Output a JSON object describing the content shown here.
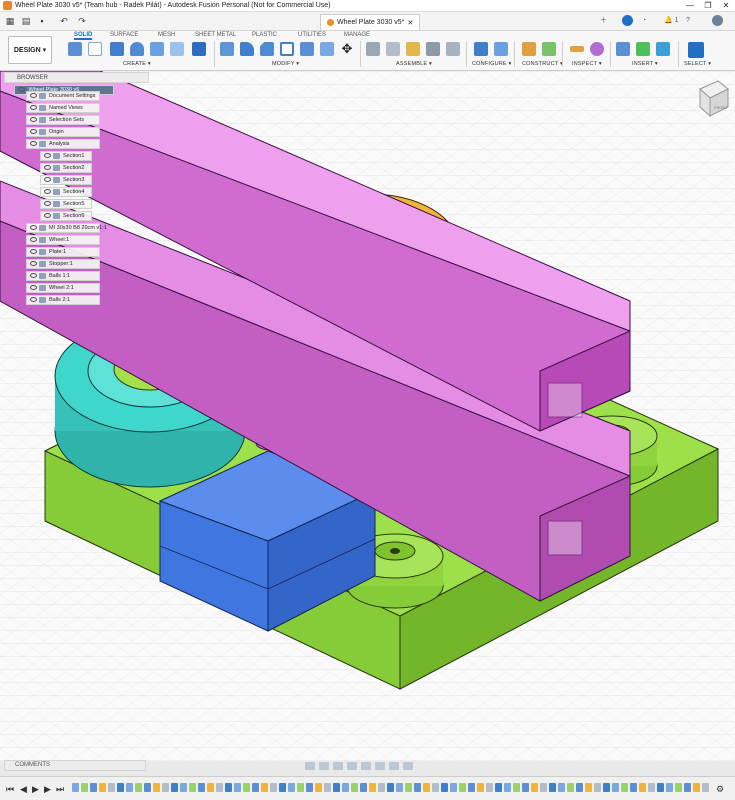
{
  "window": {
    "title": "Wheel Plate 3030 v5* (Team hub - Radek Pilát) - Autodesk Fusion Personal (Not for Commercial Use)",
    "controls": [
      "—",
      "❐",
      "✕"
    ]
  },
  "quick_access": {
    "doc_tab_label": "Wheel Plate 3030 v5*",
    "doc_tab_close": "✕",
    "notification_count": "1",
    "help_label": "?"
  },
  "ribbon": {
    "workspace_label": "DESIGN ▾",
    "tabs": [
      "SOLID",
      "SURFACE",
      "MESH",
      "SHEET METAL",
      "PLASTIC",
      "UTILITIES",
      "MANAGE"
    ],
    "active_tab": "SOLID",
    "groups": [
      "CREATE ▾",
      "MODIFY ▾",
      "ASSEMBLE ▾",
      "CONFIGURE ▾",
      "CONSTRUCT ▾",
      "INSPECT ▾",
      "INSERT ▾",
      "SELECT ▾"
    ]
  },
  "browser": {
    "header": "BROWSER",
    "root": "Wheel Plate 3030 v5",
    "items": [
      {
        "label": "Document Settings",
        "depth": 1
      },
      {
        "label": "Named Views",
        "depth": 1
      },
      {
        "label": "Selection Sets",
        "depth": 1
      },
      {
        "label": "Origin",
        "depth": 1
      },
      {
        "label": "Analysis",
        "depth": 1
      },
      {
        "label": "Section1",
        "depth": 2
      },
      {
        "label": "Section2",
        "depth": 2
      },
      {
        "label": "Section3",
        "depth": 2
      },
      {
        "label": "Section4",
        "depth": 2
      },
      {
        "label": "Section5",
        "depth": 2
      },
      {
        "label": "Section6",
        "depth": 2
      },
      {
        "label": "MI 30x30 B8 20cm v1:1",
        "depth": 1
      },
      {
        "label": "Wheel:1",
        "depth": 1
      },
      {
        "label": "Plate:1",
        "depth": 1
      },
      {
        "label": "Stopper:1",
        "depth": 1
      },
      {
        "label": "Balls 1:1",
        "depth": 1
      },
      {
        "label": "Wheel 2:1",
        "depth": 1
      },
      {
        "label": "Balls 2:1",
        "depth": 1
      }
    ]
  },
  "comments": {
    "label": "COMMENTS"
  },
  "viewcube": {
    "face_label": "FRONT"
  },
  "colors": {
    "plate": "#94dc3c",
    "rail": "#e07ae0",
    "wheel_orange": "#f0b33c",
    "wheel_teal": "#3fd6cc",
    "stopper": "#3f76e0",
    "hub": "#a5e04a",
    "bolt": "#e06fd2",
    "accent": "#1f6fc5"
  }
}
